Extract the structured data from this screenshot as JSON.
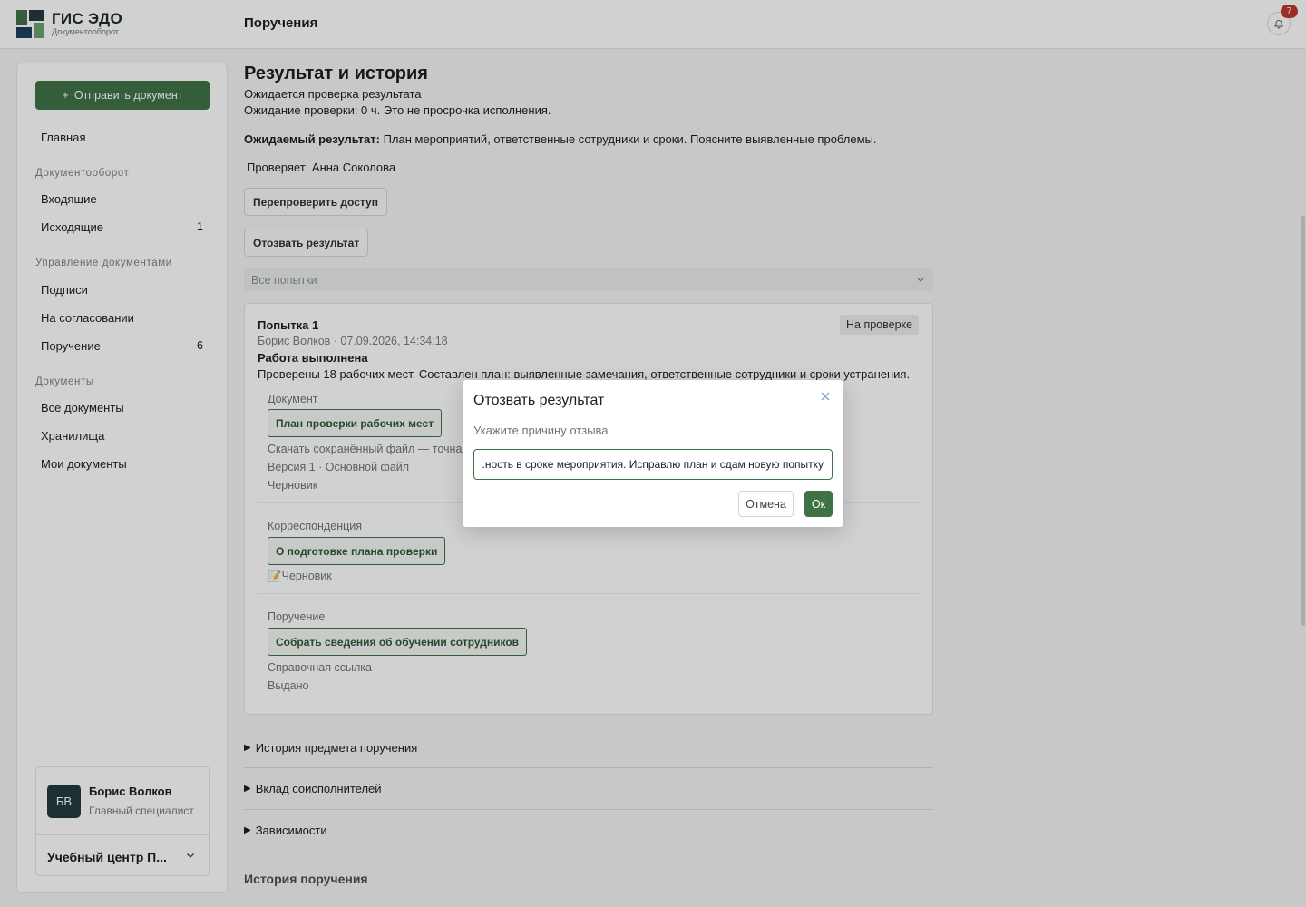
{
  "app": {
    "brand_title": "ГИС ЭДО",
    "brand_subtitle": "Документооборот",
    "page_header": "Поручения",
    "notifications_count": "7",
    "logo_colors": [
      "#3f7346",
      "#243a3f",
      "#6aa36f",
      "#1f3d62"
    ]
  },
  "sidebar": {
    "send_button": "Отправить документ",
    "home": "Главная",
    "group_docflow": "Документооборот",
    "incoming": "Входящие",
    "outgoing": "Исходящие",
    "outgoing_count": "1",
    "group_doc_mgmt": "Управление документами",
    "signatures": "Подписи",
    "on_approval": "На согласовании",
    "assignment": "Поручение",
    "assignment_count": "6",
    "group_documents": "Документы",
    "all_documents": "Все документы",
    "storages": "Хранилища",
    "my_documents": "Мои документы"
  },
  "user": {
    "initials": "БВ",
    "name": "Борис Волков",
    "role": "Главный специалист",
    "org": "Учебный центр П..."
  },
  "main": {
    "title": "Результат и история",
    "status_line": "Ожидается проверка результата",
    "waiting_line": "Ожидание проверки: 0 ч. Это не просрочка исполнения.",
    "expected_label": "Ожидаемый результат:",
    "expected_text": " План мероприятий, ответственные сотрудники и сроки. Поясните выявленные проблемы.",
    "reviewer": "Проверяет: Анна Соколова",
    "recheck_button": "Перепроверить доступ",
    "revoke_button": "Отозвать результат",
    "attempts_filter": "Все попытки",
    "history_section_title": "История поручения"
  },
  "attempt": {
    "title": "Попытка 1",
    "meta": "Борис Волков · 07.09.2026, 14:34:18",
    "status": "На проверке",
    "work_done": "Работа выполнена",
    "description": "Проверены 18 рабочих мест. Составлен план: выявленные замечания, ответственные сотрудники и сроки устранения.",
    "document_label": "Документ",
    "document_chip": "План проверки рабочих мест",
    "download_text": "Скачать сохранённый файл — точная",
    "version_text": "Версия 1 · Основной файл",
    "document_state": "Черновик",
    "correspondence_label": "Корреспонденция",
    "correspondence_chip": "О подготовке плана проверки",
    "correspondence_state": "📝Черновик",
    "assignment_label": "Поручение",
    "assignment_chip": "Собрать сведения об обучении сотрудников",
    "assignment_ref": "Справочная ссылка",
    "assignment_state": "Выдано"
  },
  "accordions": [
    "История предмета поручения",
    "Вклад соисполнителей",
    "Зависимости"
  ],
  "modal": {
    "title": "Отозвать результат",
    "label": "Укажите причину отзыва",
    "input_value": "ность в сроке мероприятия. Исправлю план и сдам новую попытку.",
    "cancel": "Отмена",
    "ok": "Ок"
  }
}
